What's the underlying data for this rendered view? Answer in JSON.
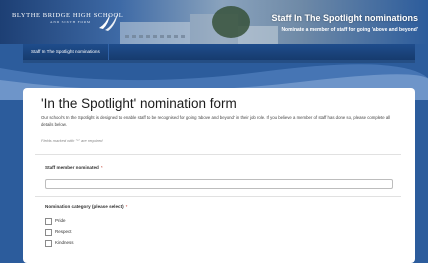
{
  "header": {
    "school_name": "BLYTHE BRIDGE HIGH SCHOOL",
    "school_motto": "AND SIXTH FORM",
    "title": "Staff In The Spotlight nominations",
    "subtitle": "Nominate a member of staff for going 'above and beyond'"
  },
  "nav": {
    "items": [
      {
        "label": "Staff In The Spotlight nominations"
      }
    ]
  },
  "form": {
    "title": "'In the Spotlight' nomination form",
    "intro": "Our school's In the Spotlight is designed to enable staff to be recognised for going 'above and beyond' in their job role. If you believe a member of staff has done so, please complete all details below.",
    "required_note": "Fields marked with \"*\" are required",
    "fields": {
      "staff_member": {
        "label": "Staff member nominated",
        "required_mark": "*",
        "value": ""
      },
      "category": {
        "label": "Nomination category (please select)",
        "required_mark": "*",
        "options": [
          {
            "label": "Pride",
            "checked": false
          },
          {
            "label": "Respect",
            "checked": false
          },
          {
            "label": "Kindness",
            "checked": false
          }
        ]
      }
    }
  },
  "colors": {
    "page_background": "#2c5c9c",
    "nav_background": "#1f4d8c",
    "card_background": "#ffffff",
    "required_star": "#c0392b"
  },
  "icons": {
    "logo": "swoosh-logo-icon",
    "checkbox": "checkbox-icon"
  }
}
